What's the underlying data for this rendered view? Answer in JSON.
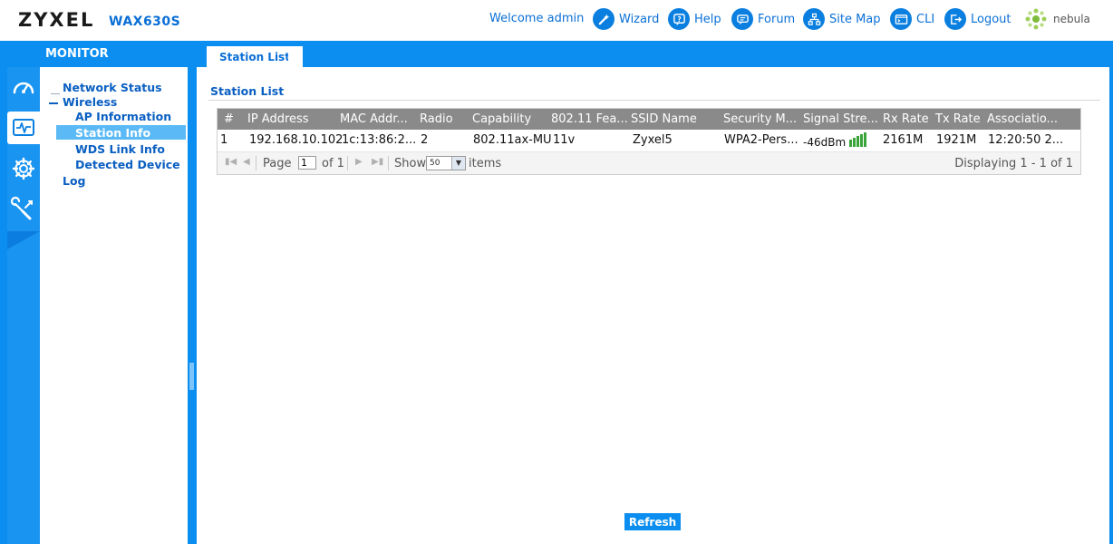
{
  "header": {
    "brand": "ZYXEL",
    "model": "WAX630S",
    "welcome": "Welcome admin",
    "links": [
      {
        "label": "Wizard",
        "icon": "wand-icon"
      },
      {
        "label": "Help",
        "icon": "help-icon"
      },
      {
        "label": "Forum",
        "icon": "forum-icon"
      },
      {
        "label": "Site Map",
        "icon": "sitemap-icon"
      },
      {
        "label": "CLI",
        "icon": "cli-icon"
      },
      {
        "label": "Logout",
        "icon": "logout-icon"
      }
    ],
    "nebula": "nebula"
  },
  "sidebar": {
    "title": "MONITOR",
    "rail": [
      "dashboard-icon",
      "monitor-icon",
      "configuration-icon",
      "maintenance-icon"
    ],
    "items": [
      {
        "label": "Network Status"
      },
      {
        "label": "Wireless"
      },
      {
        "label": "AP Information"
      },
      {
        "label": "Station Info"
      },
      {
        "label": "WDS Link Info"
      },
      {
        "label": "Detected Device"
      },
      {
        "label": "Log"
      }
    ]
  },
  "main": {
    "tab": "Station List",
    "section_title": "Station List",
    "table": {
      "columns": [
        "#",
        "IP Address",
        "MAC Addr...",
        "Radio",
        "Capability",
        "802.11 Fea...",
        "SSID Name",
        "Security M...",
        "Signal Stre...",
        "Rx Rate",
        "Tx Rate",
        "Associatio..."
      ],
      "rows": [
        {
          "index": "1",
          "ip": "192.168.10.102",
          "mac": "1c:13:86:2...",
          "radio": "2",
          "capability": "802.11ax-MU",
          "features": "11v",
          "ssid": "Zyxel5",
          "security": "WPA2-Pers...",
          "signal": "-46dBm",
          "signal_bars_lit": 5,
          "signal_bars_total": 5,
          "rx_rate": "2161M",
          "tx_rate": "1921M",
          "association": "12:20:50 2..."
        }
      ]
    },
    "pager": {
      "page_label": "Page",
      "page_value": "1",
      "of_label": "of 1",
      "show_label": "Show",
      "show_value": "50",
      "items_label": "items",
      "displaying": "Displaying 1 - 1 of 1"
    },
    "refresh_label": "Refresh"
  },
  "colors": {
    "accent": "#0b8ef0",
    "link": "#0a6fd6",
    "nav_text": "#0a5fc2",
    "table_header": "#8a8a8a",
    "signal": "#3aa33a"
  }
}
